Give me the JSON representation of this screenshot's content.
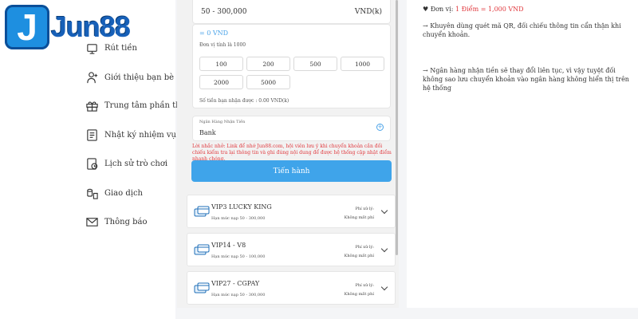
{
  "brand": {
    "logo_letter": "J",
    "logo_text": "Jun88"
  },
  "sidebar": {
    "items": [
      {
        "label": "Rút tiền",
        "icon": "withdraw-icon"
      },
      {
        "label": "Giới thiệu bạn bè",
        "icon": "refer-friend-icon"
      },
      {
        "label": "Trung tâm phần thưởng",
        "icon": "gift-icon"
      },
      {
        "label": "Nhật ký nhiệm vụ",
        "icon": "task-log-icon"
      },
      {
        "label": "Lịch sử trò chơi",
        "icon": "history-icon"
      },
      {
        "label": "Giao dịch",
        "icon": "transaction-icon"
      },
      {
        "label": "Thông báo",
        "icon": "mail-icon"
      }
    ]
  },
  "deposit": {
    "range": "50 - 300,000",
    "currency": "VND(k)",
    "amount_value": "= 0 VND",
    "unit_hint": "Đơn vị tính là 1000",
    "chips": [
      "100",
      "200",
      "500",
      "1000",
      "2000",
      "5000"
    ],
    "receive_text": "Số tiền bạn nhận được : 0.00 VND(k)",
    "bank_label": "Ngân Hàng Nhận Tiền",
    "bank_value": "Bank",
    "note": "Lời nhắc nhở: Link để nhớ Jun88.com, hội viên lưu ý khi chuyển khoản cần đối chiếu kiểm tra lại thông tin và ghi đúng nội dung để được hệ thống cập nhật điểm nhanh chóng.",
    "proceed_label": "Tiến hành"
  },
  "vip_options": [
    {
      "name": "VIP3 LUCKY KING",
      "limit": "Hạn mức nạp 50 - 300,000",
      "fee_label": "Phí xử lý:",
      "fee_value": "Không mất phí"
    },
    {
      "name": "VIP14 - V8",
      "limit": "Hạn mức nạp 50 - 100,000",
      "fee_label": "Phí xử lý:",
      "fee_value": "Không mất phí"
    },
    {
      "name": "VIP27 - CGPAY",
      "limit": "Hạn mức nạp 50 - 300,000",
      "fee_label": "Phí xử lý:",
      "fee_value": "Không mất phí"
    }
  ],
  "info": {
    "unit_prefix": "♥ Đơn vị: ",
    "unit_value": "1 Điểm = 1,000 VND",
    "tip1": "→ Khuyên dùng quét mã QR, đối chiếu thông tin cẩn thận khi chuyển khoản.",
    "tip2": "→ Ngân hàng nhận tiền sẽ thay đổi liên tục, vì vậy tuyệt đối không sao lưu chuyển khoản vào ngân hàng không hiển thị trên hệ thống"
  },
  "colors": {
    "accent": "#3fa4ea",
    "warning": "#e0393e",
    "brand": "#1760b8"
  }
}
